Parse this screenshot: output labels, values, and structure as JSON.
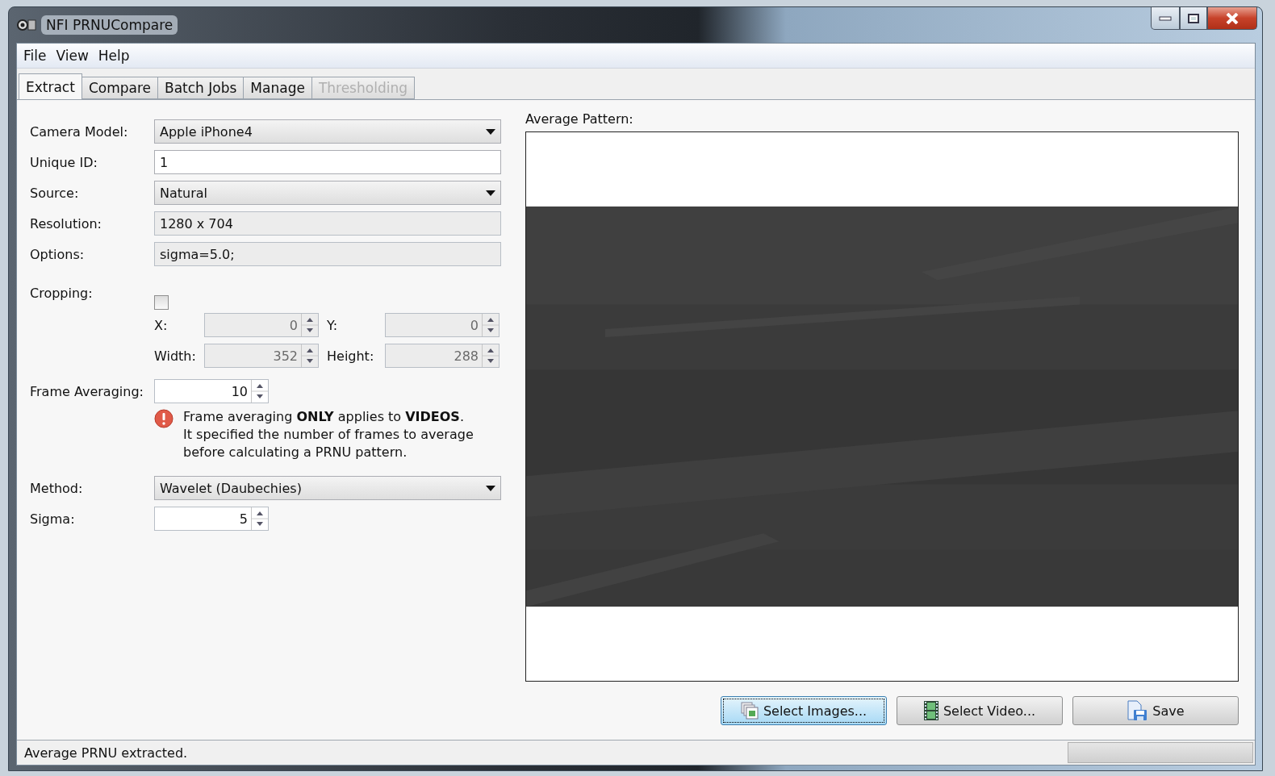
{
  "window": {
    "title": "NFI PRNUCompare"
  },
  "menu": [
    "File",
    "View",
    "Help"
  ],
  "tabs": [
    {
      "label": "Extract",
      "selected": true,
      "disabled": false
    },
    {
      "label": "Compare",
      "selected": false,
      "disabled": false
    },
    {
      "label": "Batch Jobs",
      "selected": false,
      "disabled": false
    },
    {
      "label": "Manage",
      "selected": false,
      "disabled": false
    },
    {
      "label": "Thresholding",
      "selected": false,
      "disabled": true
    }
  ],
  "fields": [
    {
      "label": "Camera Model:",
      "kind": "dropdown",
      "value": "Apple iPhone4",
      "disabled": false
    },
    {
      "label": "Unique ID:",
      "kind": "input",
      "value": "1",
      "disabled": false
    },
    {
      "label": "Source:",
      "kind": "dropdown",
      "value": "Natural",
      "disabled": false
    },
    {
      "label": "Resolution:",
      "kind": "input",
      "value": "1280 x 704",
      "disabled": true
    },
    {
      "label": "Options:",
      "kind": "input",
      "value": "sigma=5.0;",
      "disabled": true
    }
  ],
  "cropping": {
    "label": "Cropping:",
    "checked": false,
    "spins": [
      {
        "label": "X:",
        "value": "0",
        "disabled": true
      },
      {
        "label": "Y:",
        "value": "0",
        "disabled": true
      },
      {
        "label": "Width:",
        "value": "352",
        "disabled": true
      },
      {
        "label": "Height:",
        "value": "288",
        "disabled": true
      }
    ]
  },
  "frame_averaging": {
    "label": "Frame Averaging:",
    "value": "10",
    "disabled": false
  },
  "notice": [
    "Frame averaging **ONLY** applies to **VIDEOS**.",
    "It specified the number of frames to average",
    "before calculating a PRNU pattern."
  ],
  "method": {
    "label": "Method:",
    "value": "Wavelet (Daubechies)"
  },
  "sigma": {
    "label": "Sigma:",
    "value": "5",
    "disabled": false
  },
  "pattern": {
    "label": "Average Pattern:",
    "kind": "picture"
  },
  "buttons": [
    {
      "label": "Select Images...",
      "kind": "images",
      "focused": true
    },
    {
      "label": "Select Video...",
      "kind": "video",
      "focused": false
    },
    {
      "label": "Save",
      "kind": "save",
      "focused": false
    }
  ],
  "status_bar": {
    "text": "Average PRNU extracted.",
    "progress": {
      "level": 0
    }
  }
}
